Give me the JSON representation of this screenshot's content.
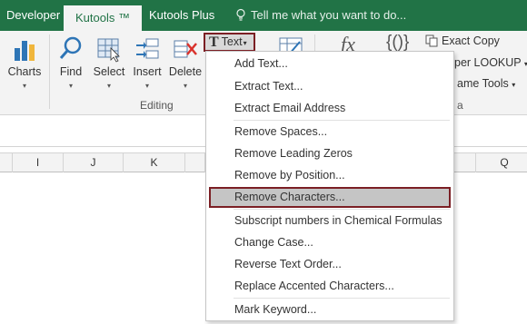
{
  "tabs": [
    {
      "label": "Developer",
      "active": false
    },
    {
      "label": "Kutools ™",
      "active": true
    },
    {
      "label": "Kutools Plus",
      "active": false
    }
  ],
  "tell_me": "Tell me what you want to do...",
  "ribbon": {
    "buttons": [
      {
        "label": "Charts",
        "icon": "charts-icon"
      },
      {
        "label": "Find",
        "icon": "find-icon"
      },
      {
        "label": "Select",
        "icon": "select-icon"
      },
      {
        "label": "Insert",
        "icon": "insert-icon"
      },
      {
        "label": "Delete",
        "icon": "delete-icon"
      }
    ],
    "group_label": "Editing",
    "text_button": "Text",
    "right_items": [
      "Exact Copy",
      "per LOOKUP",
      "ame Tools",
      "a"
    ]
  },
  "column_headers": [
    "I",
    "J",
    "K",
    "Q"
  ],
  "menu": {
    "groups": [
      [
        "Add Text...",
        "Extract Text...",
        "Extract Email Address"
      ],
      [
        "Remove Spaces...",
        "Remove Leading Zeros",
        "Remove by Position...",
        "Remove Characters..."
      ],
      [
        "Subscript numbers in Chemical Formulas",
        "Change Case...",
        "Reverse Text Order...",
        "Replace Accented Characters..."
      ],
      [
        "Mark Keyword..."
      ]
    ],
    "highlighted": "Remove Characters..."
  },
  "colors": {
    "brand": "#217346",
    "highlight_border": "#7b1f24",
    "highlight_fill": "#c5c5c5"
  }
}
